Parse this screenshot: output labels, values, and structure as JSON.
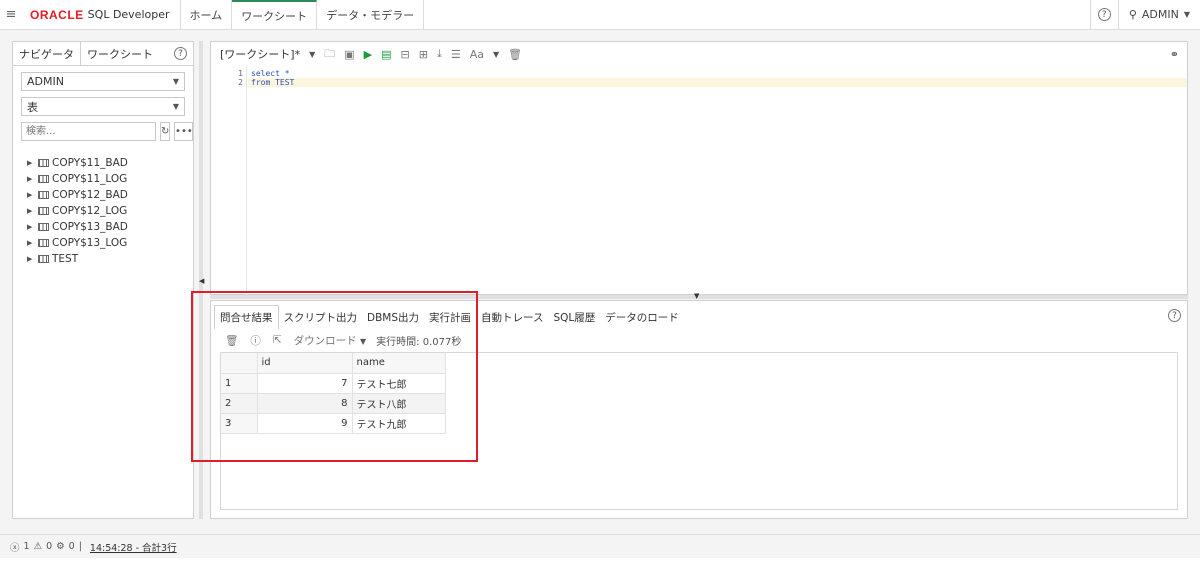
{
  "topbar": {
    "menu_icon": "hamburger-icon",
    "oracle": "ORACLE",
    "product": "SQL Developer",
    "tabs": [
      "ホーム",
      "ワークシート",
      "データ・モデラー"
    ],
    "user": "ADMIN"
  },
  "navigator": {
    "tabs": [
      "ナビゲータ",
      "ワークシート"
    ],
    "schema": "ADMIN",
    "object_type": "表",
    "search_placeholder": "検索...",
    "tables": [
      "COPY$11_BAD",
      "COPY$11_LOG",
      "COPY$12_BAD",
      "COPY$12_LOG",
      "COPY$13_BAD",
      "COPY$13_LOG",
      "TEST"
    ]
  },
  "editor": {
    "worksheet_title": "[ワークシート]*",
    "font_button": "Aa",
    "lines": [
      {
        "num": "1",
        "text": "select *"
      },
      {
        "num": "2",
        "text": "from TEST"
      }
    ]
  },
  "results": {
    "tabs": [
      "問合せ結果",
      "スクリプト出力",
      "DBMS出力",
      "実行計画",
      "自動トレース",
      "SQL履歴",
      "データのロード"
    ],
    "download": "ダウンロード",
    "exec_time": "実行時間: 0.077秒",
    "columns": [
      "id",
      "name"
    ],
    "rows": [
      {
        "n": "1",
        "id": "7",
        "name": "テスト七郎"
      },
      {
        "n": "2",
        "id": "8",
        "name": "テスト八郎"
      },
      {
        "n": "3",
        "id": "9",
        "name": "テスト九郎"
      }
    ]
  },
  "status": {
    "errors": "1",
    "warnings": "0",
    "settings": "0",
    "separator": "|",
    "message": "14:54:28 - 合計3行"
  },
  "colors": {
    "oracle_red": "#e31b23",
    "highlight_box": "#e01e2b",
    "run_green": "#1a9d3c",
    "active_tab": "#2e8b57"
  }
}
